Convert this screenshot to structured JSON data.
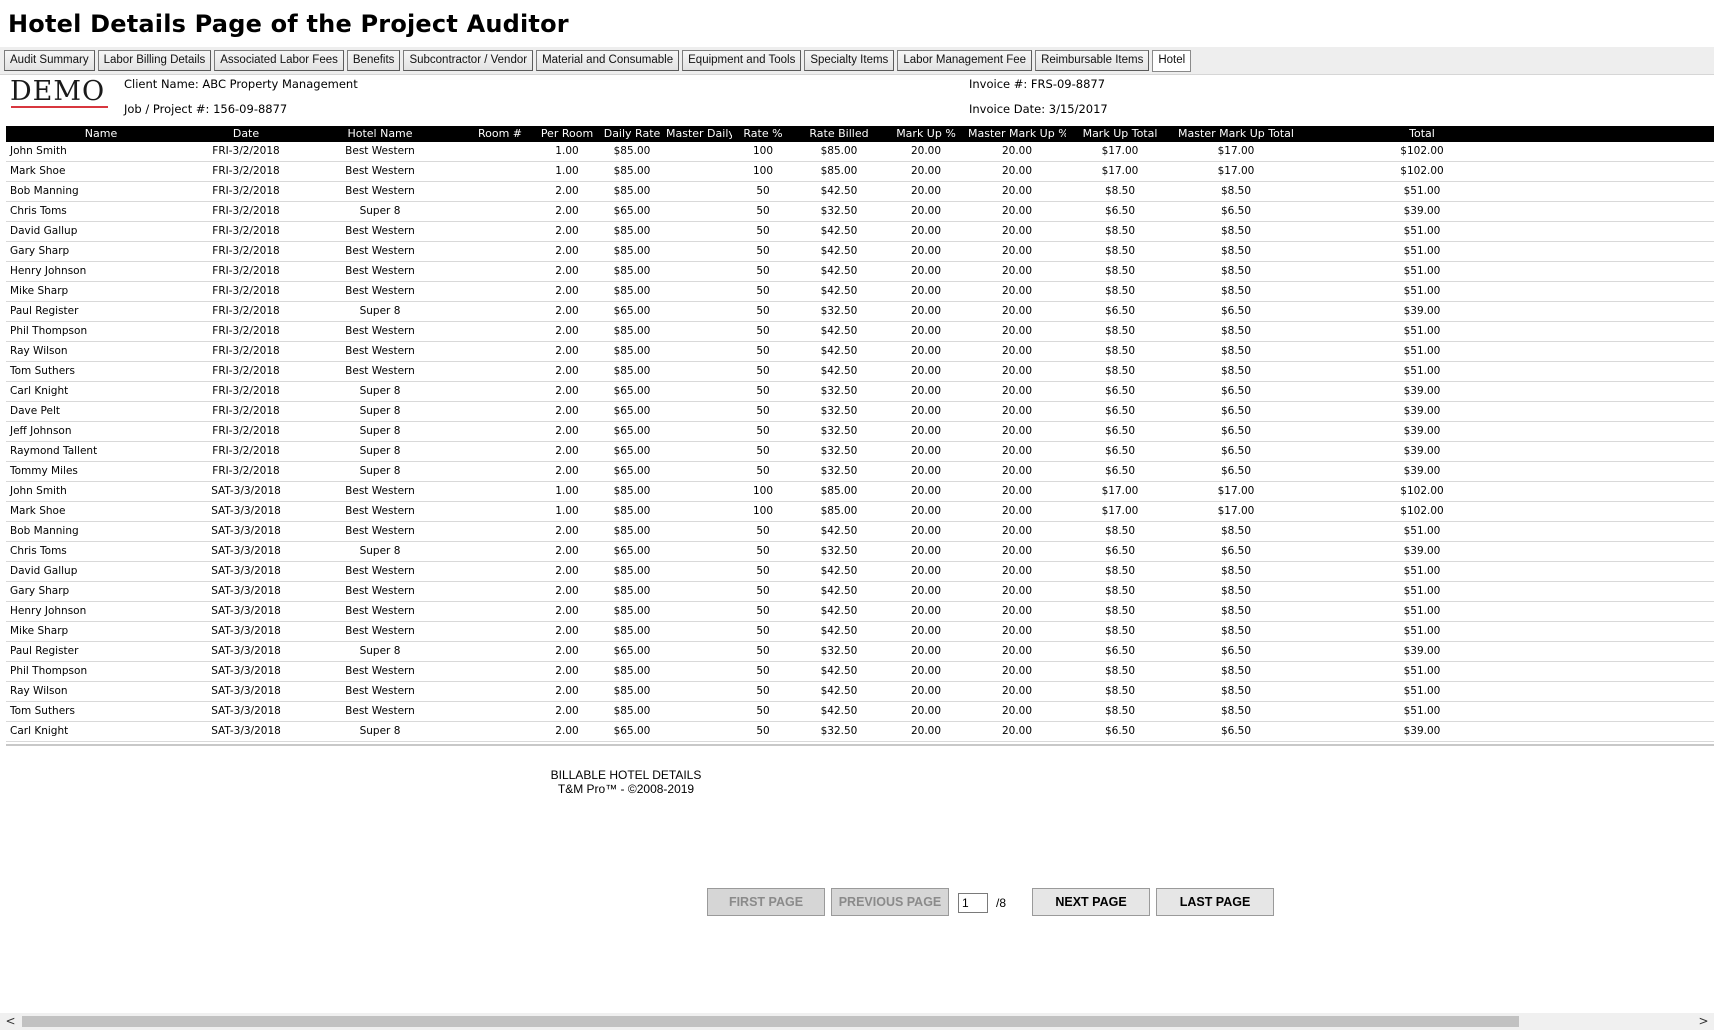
{
  "page": {
    "title": "Hotel Details Page of the Project Auditor"
  },
  "tabs": [
    {
      "label": "Audit Summary",
      "active": false
    },
    {
      "label": "Labor Billing Details",
      "active": false
    },
    {
      "label": "Associated Labor Fees",
      "active": false
    },
    {
      "label": "Benefits",
      "active": false
    },
    {
      "label": "Subcontractor / Vendor",
      "active": false
    },
    {
      "label": "Material and Consumable",
      "active": false
    },
    {
      "label": "Equipment and Tools",
      "active": false
    },
    {
      "label": "Specialty Items",
      "active": false
    },
    {
      "label": "Labor Management Fee",
      "active": false
    },
    {
      "label": "Reimbursable Items",
      "active": false
    },
    {
      "label": "Hotel",
      "active": true
    }
  ],
  "report": {
    "logo_text": "DEMO",
    "client_name": "Client Name: ABC Property Management",
    "job_project": "Job / Project #: 156-09-8877",
    "invoice_number": "Invoice #: FRS-09-8877",
    "invoice_date": "Invoice Date: 3/15/2017",
    "columns": [
      "Name",
      "Date",
      "Hotel Name",
      "Room #",
      "Per Room",
      "Daily Rate",
      "Master Daily Rate",
      "Rate %",
      "Rate Billed",
      "Mark Up %",
      "Master Mark Up %",
      "Mark Up Total",
      "Master Mark Up Total",
      "Total"
    ],
    "rows": [
      [
        "John Smith",
        "FRI-3/2/2018",
        "Best Western",
        "",
        "1.00",
        "$85.00",
        "",
        "100",
        "$85.00",
        "20.00",
        "20.00",
        "$17.00",
        "$17.00",
        "$102.00"
      ],
      [
        "Mark Shoe",
        "FRI-3/2/2018",
        "Best Western",
        "",
        "1.00",
        "$85.00",
        "",
        "100",
        "$85.00",
        "20.00",
        "20.00",
        "$17.00",
        "$17.00",
        "$102.00"
      ],
      [
        "Bob Manning",
        "FRI-3/2/2018",
        "Best Western",
        "",
        "2.00",
        "$85.00",
        "",
        "50",
        "$42.50",
        "20.00",
        "20.00",
        "$8.50",
        "$8.50",
        "$51.00"
      ],
      [
        "Chris Toms",
        "FRI-3/2/2018",
        "Super 8",
        "",
        "2.00",
        "$65.00",
        "",
        "50",
        "$32.50",
        "20.00",
        "20.00",
        "$6.50",
        "$6.50",
        "$39.00"
      ],
      [
        "David Gallup",
        "FRI-3/2/2018",
        "Best Western",
        "",
        "2.00",
        "$85.00",
        "",
        "50",
        "$42.50",
        "20.00",
        "20.00",
        "$8.50",
        "$8.50",
        "$51.00"
      ],
      [
        "Gary Sharp",
        "FRI-3/2/2018",
        "Best Western",
        "",
        "2.00",
        "$85.00",
        "",
        "50",
        "$42.50",
        "20.00",
        "20.00",
        "$8.50",
        "$8.50",
        "$51.00"
      ],
      [
        "Henry Johnson",
        "FRI-3/2/2018",
        "Best Western",
        "",
        "2.00",
        "$85.00",
        "",
        "50",
        "$42.50",
        "20.00",
        "20.00",
        "$8.50",
        "$8.50",
        "$51.00"
      ],
      [
        "Mike Sharp",
        "FRI-3/2/2018",
        "Best Western",
        "",
        "2.00",
        "$85.00",
        "",
        "50",
        "$42.50",
        "20.00",
        "20.00",
        "$8.50",
        "$8.50",
        "$51.00"
      ],
      [
        "Paul Register",
        "FRI-3/2/2018",
        "Super 8",
        "",
        "2.00",
        "$65.00",
        "",
        "50",
        "$32.50",
        "20.00",
        "20.00",
        "$6.50",
        "$6.50",
        "$39.00"
      ],
      [
        "Phil Thompson",
        "FRI-3/2/2018",
        "Best Western",
        "",
        "2.00",
        "$85.00",
        "",
        "50",
        "$42.50",
        "20.00",
        "20.00",
        "$8.50",
        "$8.50",
        "$51.00"
      ],
      [
        "Ray Wilson",
        "FRI-3/2/2018",
        "Best Western",
        "",
        "2.00",
        "$85.00",
        "",
        "50",
        "$42.50",
        "20.00",
        "20.00",
        "$8.50",
        "$8.50",
        "$51.00"
      ],
      [
        "Tom Suthers",
        "FRI-3/2/2018",
        "Best Western",
        "",
        "2.00",
        "$85.00",
        "",
        "50",
        "$42.50",
        "20.00",
        "20.00",
        "$8.50",
        "$8.50",
        "$51.00"
      ],
      [
        "Carl Knight",
        "FRI-3/2/2018",
        "Super 8",
        "",
        "2.00",
        "$65.00",
        "",
        "50",
        "$32.50",
        "20.00",
        "20.00",
        "$6.50",
        "$6.50",
        "$39.00"
      ],
      [
        "Dave Pelt",
        "FRI-3/2/2018",
        "Super 8",
        "",
        "2.00",
        "$65.00",
        "",
        "50",
        "$32.50",
        "20.00",
        "20.00",
        "$6.50",
        "$6.50",
        "$39.00"
      ],
      [
        "Jeff Johnson",
        "FRI-3/2/2018",
        "Super 8",
        "",
        "2.00",
        "$65.00",
        "",
        "50",
        "$32.50",
        "20.00",
        "20.00",
        "$6.50",
        "$6.50",
        "$39.00"
      ],
      [
        "Raymond Tallent",
        "FRI-3/2/2018",
        "Super 8",
        "",
        "2.00",
        "$65.00",
        "",
        "50",
        "$32.50",
        "20.00",
        "20.00",
        "$6.50",
        "$6.50",
        "$39.00"
      ],
      [
        "Tommy Miles",
        "FRI-3/2/2018",
        "Super 8",
        "",
        "2.00",
        "$65.00",
        "",
        "50",
        "$32.50",
        "20.00",
        "20.00",
        "$6.50",
        "$6.50",
        "$39.00"
      ],
      [
        "John Smith",
        "SAT-3/3/2018",
        "Best Western",
        "",
        "1.00",
        "$85.00",
        "",
        "100",
        "$85.00",
        "20.00",
        "20.00",
        "$17.00",
        "$17.00",
        "$102.00"
      ],
      [
        "Mark Shoe",
        "SAT-3/3/2018",
        "Best Western",
        "",
        "1.00",
        "$85.00",
        "",
        "100",
        "$85.00",
        "20.00",
        "20.00",
        "$17.00",
        "$17.00",
        "$102.00"
      ],
      [
        "Bob Manning",
        "SAT-3/3/2018",
        "Best Western",
        "",
        "2.00",
        "$85.00",
        "",
        "50",
        "$42.50",
        "20.00",
        "20.00",
        "$8.50",
        "$8.50",
        "$51.00"
      ],
      [
        "Chris Toms",
        "SAT-3/3/2018",
        "Super 8",
        "",
        "2.00",
        "$65.00",
        "",
        "50",
        "$32.50",
        "20.00",
        "20.00",
        "$6.50",
        "$6.50",
        "$39.00"
      ],
      [
        "David Gallup",
        "SAT-3/3/2018",
        "Best Western",
        "",
        "2.00",
        "$85.00",
        "",
        "50",
        "$42.50",
        "20.00",
        "20.00",
        "$8.50",
        "$8.50",
        "$51.00"
      ],
      [
        "Gary Sharp",
        "SAT-3/3/2018",
        "Best Western",
        "",
        "2.00",
        "$85.00",
        "",
        "50",
        "$42.50",
        "20.00",
        "20.00",
        "$8.50",
        "$8.50",
        "$51.00"
      ],
      [
        "Henry Johnson",
        "SAT-3/3/2018",
        "Best Western",
        "",
        "2.00",
        "$85.00",
        "",
        "50",
        "$42.50",
        "20.00",
        "20.00",
        "$8.50",
        "$8.50",
        "$51.00"
      ],
      [
        "Mike Sharp",
        "SAT-3/3/2018",
        "Best Western",
        "",
        "2.00",
        "$85.00",
        "",
        "50",
        "$42.50",
        "20.00",
        "20.00",
        "$8.50",
        "$8.50",
        "$51.00"
      ],
      [
        "Paul Register",
        "SAT-3/3/2018",
        "Super 8",
        "",
        "2.00",
        "$65.00",
        "",
        "50",
        "$32.50",
        "20.00",
        "20.00",
        "$6.50",
        "$6.50",
        "$39.00"
      ],
      [
        "Phil Thompson",
        "SAT-3/3/2018",
        "Best Western",
        "",
        "2.00",
        "$85.00",
        "",
        "50",
        "$42.50",
        "20.00",
        "20.00",
        "$8.50",
        "$8.50",
        "$51.00"
      ],
      [
        "Ray Wilson",
        "SAT-3/3/2018",
        "Best Western",
        "",
        "2.00",
        "$85.00",
        "",
        "50",
        "$42.50",
        "20.00",
        "20.00",
        "$8.50",
        "$8.50",
        "$51.00"
      ],
      [
        "Tom Suthers",
        "SAT-3/3/2018",
        "Best Western",
        "",
        "2.00",
        "$85.00",
        "",
        "50",
        "$42.50",
        "20.00",
        "20.00",
        "$8.50",
        "$8.50",
        "$51.00"
      ],
      [
        "Carl Knight",
        "SAT-3/3/2018",
        "Super 8",
        "",
        "2.00",
        "$65.00",
        "",
        "50",
        "$32.50",
        "20.00",
        "20.00",
        "$6.50",
        "$6.50",
        "$39.00"
      ]
    ],
    "footer_line1": "BILLABLE HOTEL DETAILS",
    "footer_line2": "T&M Pro™ - ©2008-2019"
  },
  "pager": {
    "first_label": "FIRST PAGE",
    "previous_label": "PREVIOUS PAGE",
    "current_page": "1",
    "total_pages": "/8",
    "next_label": "NEXT PAGE",
    "last_label": "LAST PAGE"
  },
  "scrollbar": {
    "left_arrow": "<",
    "right_arrow": ">"
  },
  "colors": {
    "header_bg": "#000000",
    "logo_accent": "#d8373f",
    "tabbar_bg": "#eeeeee"
  }
}
